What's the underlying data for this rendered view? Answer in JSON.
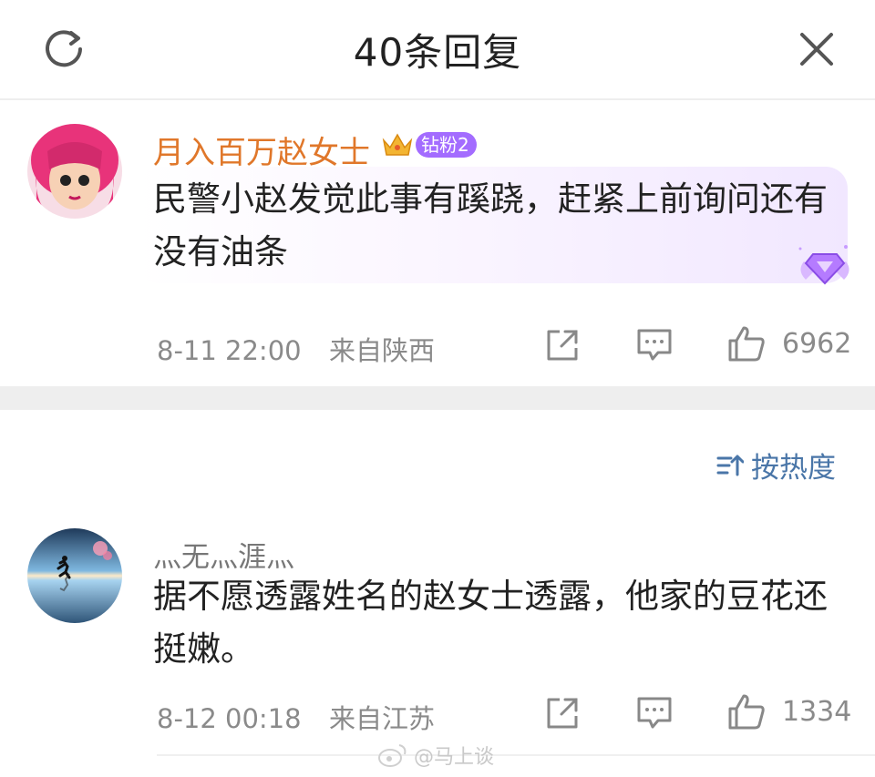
{
  "header": {
    "title": "40条回复",
    "refresh_icon": "refresh-icon",
    "close_icon": "close-icon"
  },
  "main_comment": {
    "username": "月入百万赵女士",
    "username_color": "#e0772a",
    "badge_label": "钻粉2",
    "text": "民警小赵发觉此事有蹊跷，赶紧上前询问还有没有油条",
    "time": "8-11 22:00",
    "location": "来自陕西",
    "likes": "6962"
  },
  "sort": {
    "label": "按热度",
    "icon": "sort-icon"
  },
  "reply": {
    "username": "灬无灬涯灬",
    "username_color": "#777777",
    "text": "据不愿透露姓名的赵女士透露，他家的豆花还挺嫩。",
    "time": "8-12 00:18",
    "location": "来自江苏",
    "likes": "1334"
  },
  "watermark": "@马上谈",
  "colors": {
    "link_blue": "#4a76a8",
    "badge_purple": "#a36cff",
    "meta_gray": "#8a8a8a"
  }
}
